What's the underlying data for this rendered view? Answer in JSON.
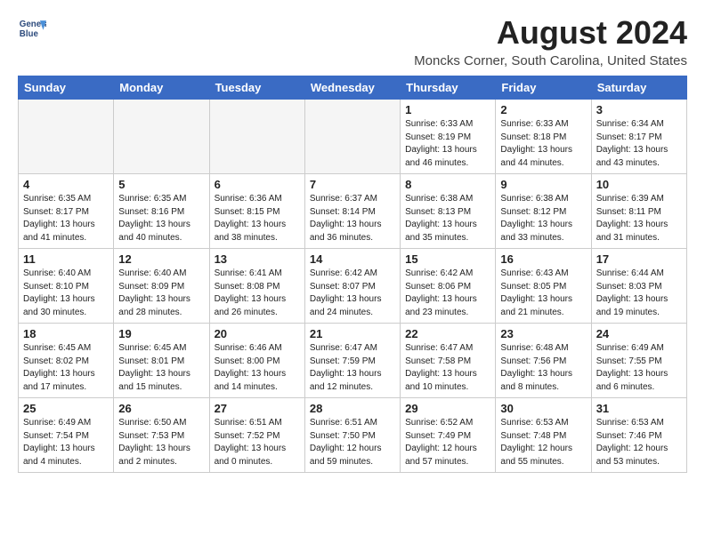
{
  "header": {
    "logo_line1": "General",
    "logo_line2": "Blue",
    "title": "August 2024",
    "subtitle": "Moncks Corner, South Carolina, United States"
  },
  "columns": [
    "Sunday",
    "Monday",
    "Tuesday",
    "Wednesday",
    "Thursday",
    "Friday",
    "Saturday"
  ],
  "weeks": [
    [
      {
        "day": "",
        "info": ""
      },
      {
        "day": "",
        "info": ""
      },
      {
        "day": "",
        "info": ""
      },
      {
        "day": "",
        "info": ""
      },
      {
        "day": "1",
        "info": "Sunrise: 6:33 AM\nSunset: 8:19 PM\nDaylight: 13 hours\nand 46 minutes."
      },
      {
        "day": "2",
        "info": "Sunrise: 6:33 AM\nSunset: 8:18 PM\nDaylight: 13 hours\nand 44 minutes."
      },
      {
        "day": "3",
        "info": "Sunrise: 6:34 AM\nSunset: 8:17 PM\nDaylight: 13 hours\nand 43 minutes."
      }
    ],
    [
      {
        "day": "4",
        "info": "Sunrise: 6:35 AM\nSunset: 8:17 PM\nDaylight: 13 hours\nand 41 minutes."
      },
      {
        "day": "5",
        "info": "Sunrise: 6:35 AM\nSunset: 8:16 PM\nDaylight: 13 hours\nand 40 minutes."
      },
      {
        "day": "6",
        "info": "Sunrise: 6:36 AM\nSunset: 8:15 PM\nDaylight: 13 hours\nand 38 minutes."
      },
      {
        "day": "7",
        "info": "Sunrise: 6:37 AM\nSunset: 8:14 PM\nDaylight: 13 hours\nand 36 minutes."
      },
      {
        "day": "8",
        "info": "Sunrise: 6:38 AM\nSunset: 8:13 PM\nDaylight: 13 hours\nand 35 minutes."
      },
      {
        "day": "9",
        "info": "Sunrise: 6:38 AM\nSunset: 8:12 PM\nDaylight: 13 hours\nand 33 minutes."
      },
      {
        "day": "10",
        "info": "Sunrise: 6:39 AM\nSunset: 8:11 PM\nDaylight: 13 hours\nand 31 minutes."
      }
    ],
    [
      {
        "day": "11",
        "info": "Sunrise: 6:40 AM\nSunset: 8:10 PM\nDaylight: 13 hours\nand 30 minutes."
      },
      {
        "day": "12",
        "info": "Sunrise: 6:40 AM\nSunset: 8:09 PM\nDaylight: 13 hours\nand 28 minutes."
      },
      {
        "day": "13",
        "info": "Sunrise: 6:41 AM\nSunset: 8:08 PM\nDaylight: 13 hours\nand 26 minutes."
      },
      {
        "day": "14",
        "info": "Sunrise: 6:42 AM\nSunset: 8:07 PM\nDaylight: 13 hours\nand 24 minutes."
      },
      {
        "day": "15",
        "info": "Sunrise: 6:42 AM\nSunset: 8:06 PM\nDaylight: 13 hours\nand 23 minutes."
      },
      {
        "day": "16",
        "info": "Sunrise: 6:43 AM\nSunset: 8:05 PM\nDaylight: 13 hours\nand 21 minutes."
      },
      {
        "day": "17",
        "info": "Sunrise: 6:44 AM\nSunset: 8:03 PM\nDaylight: 13 hours\nand 19 minutes."
      }
    ],
    [
      {
        "day": "18",
        "info": "Sunrise: 6:45 AM\nSunset: 8:02 PM\nDaylight: 13 hours\nand 17 minutes."
      },
      {
        "day": "19",
        "info": "Sunrise: 6:45 AM\nSunset: 8:01 PM\nDaylight: 13 hours\nand 15 minutes."
      },
      {
        "day": "20",
        "info": "Sunrise: 6:46 AM\nSunset: 8:00 PM\nDaylight: 13 hours\nand 14 minutes."
      },
      {
        "day": "21",
        "info": "Sunrise: 6:47 AM\nSunset: 7:59 PM\nDaylight: 13 hours\nand 12 minutes."
      },
      {
        "day": "22",
        "info": "Sunrise: 6:47 AM\nSunset: 7:58 PM\nDaylight: 13 hours\nand 10 minutes."
      },
      {
        "day": "23",
        "info": "Sunrise: 6:48 AM\nSunset: 7:56 PM\nDaylight: 13 hours\nand 8 minutes."
      },
      {
        "day": "24",
        "info": "Sunrise: 6:49 AM\nSunset: 7:55 PM\nDaylight: 13 hours\nand 6 minutes."
      }
    ],
    [
      {
        "day": "25",
        "info": "Sunrise: 6:49 AM\nSunset: 7:54 PM\nDaylight: 13 hours\nand 4 minutes."
      },
      {
        "day": "26",
        "info": "Sunrise: 6:50 AM\nSunset: 7:53 PM\nDaylight: 13 hours\nand 2 minutes."
      },
      {
        "day": "27",
        "info": "Sunrise: 6:51 AM\nSunset: 7:52 PM\nDaylight: 13 hours\nand 0 minutes."
      },
      {
        "day": "28",
        "info": "Sunrise: 6:51 AM\nSunset: 7:50 PM\nDaylight: 12 hours\nand 59 minutes."
      },
      {
        "day": "29",
        "info": "Sunrise: 6:52 AM\nSunset: 7:49 PM\nDaylight: 12 hours\nand 57 minutes."
      },
      {
        "day": "30",
        "info": "Sunrise: 6:53 AM\nSunset: 7:48 PM\nDaylight: 12 hours\nand 55 minutes."
      },
      {
        "day": "31",
        "info": "Sunrise: 6:53 AM\nSunset: 7:46 PM\nDaylight: 12 hours\nand 53 minutes."
      }
    ]
  ]
}
